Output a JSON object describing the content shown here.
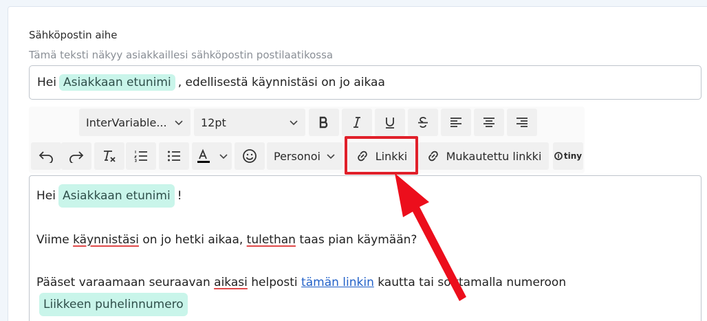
{
  "form": {
    "label": "Sähköpostin aihe",
    "hint": "Tämä teksti näkyy asiakkaillesi sähköpostin postilaatikossa",
    "subject": {
      "before": "Hei",
      "chip": "Asiakkaan etunimi",
      "after": ", edellisestä käynnistäsi on jo aikaa"
    }
  },
  "toolbar": {
    "font_family": "InterVariable...",
    "font_size": "12pt",
    "personalize_label": "Personoi",
    "link_label": "Linkki",
    "custom_link_label": "Mukautettu linkki",
    "tiny_label": "tiny"
  },
  "editor": {
    "line1": {
      "text": "Hei",
      "chip": "Asiakkaan etunimi",
      "end": "!"
    },
    "line2": {
      "p1": "Viime ",
      "w1": "käynnistäsi",
      "p2": " on jo hetki aikaa, ",
      "w2": "tulethan",
      "p3": " taas pian käymään?"
    },
    "line3": {
      "p1": "Pääset varaamaan seuraavan ",
      "w1": "aikasi",
      "p2": " helposti ",
      "link": "tämän linkin",
      "p3": " kautta tai soittamalla numeroon",
      "chip": "Liikkeen puhelinnumero"
    }
  },
  "colors": {
    "chip_bg": "#c9f5ea",
    "highlight": "#e0202a",
    "link": "#2261c8"
  },
  "icons": [
    "chevron-down-icon",
    "bold-icon",
    "italic-icon",
    "underline-icon",
    "strikethrough-icon",
    "align-left-icon",
    "align-center-icon",
    "align-right-icon",
    "undo-icon",
    "redo-icon",
    "clear-format-icon",
    "numbered-list-icon",
    "bullet-list-icon",
    "text-color-icon",
    "emoji-icon",
    "link-icon",
    "tiny-logo-icon",
    "arrow-annotation-icon"
  ]
}
